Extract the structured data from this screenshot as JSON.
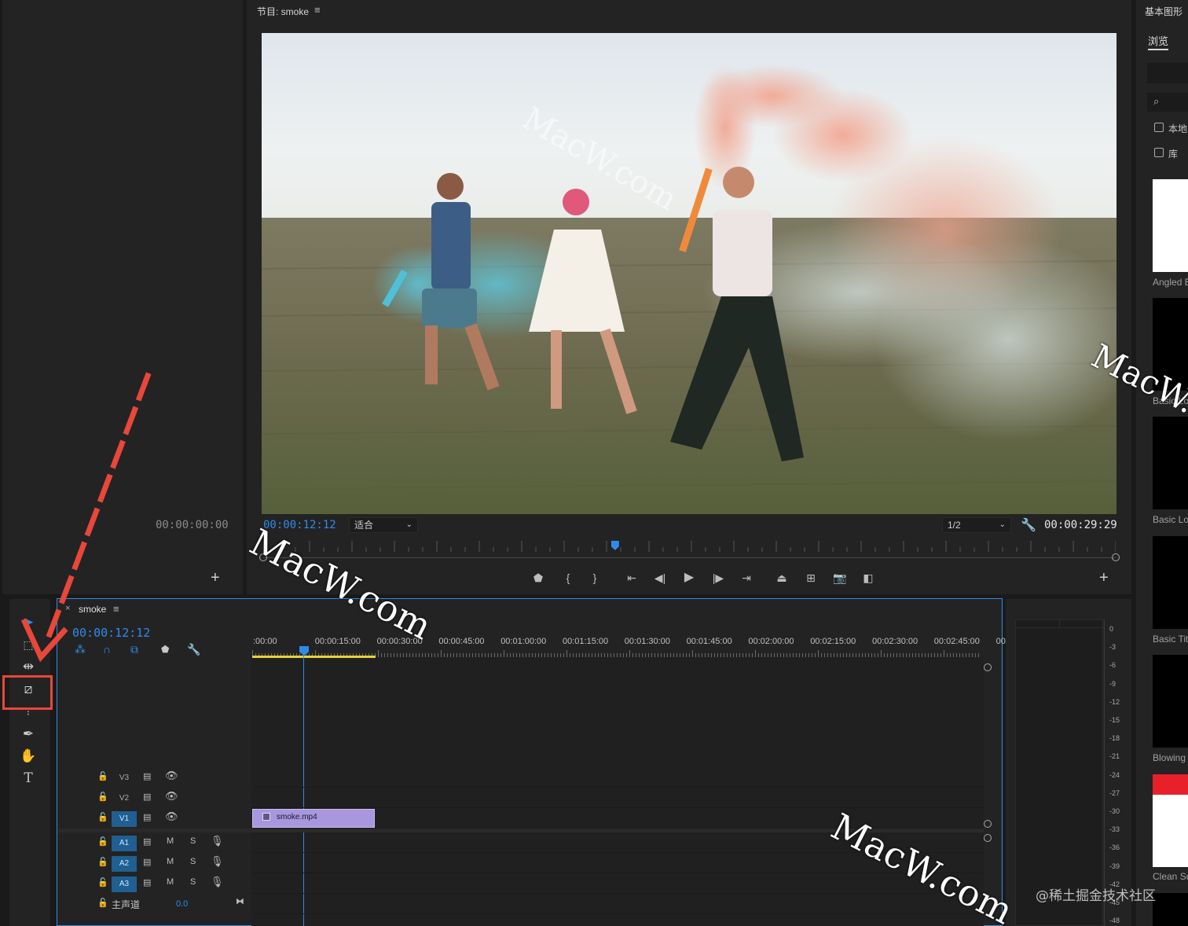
{
  "source_monitor": {
    "timecode": "00:00:00:00",
    "add_label": "+"
  },
  "program_monitor": {
    "title": "节目: smoke",
    "menu_icon": "≡",
    "timecode": "00:00:12:12",
    "zoom_select": "适合",
    "resolution_select": "1/2",
    "duration": "00:00:29:29",
    "add_label": "+",
    "playhead_progress": 0.41
  },
  "graphics_panel": {
    "title": "基本图形",
    "tab_browse": "浏览",
    "local_label": "本地",
    "lib_label": "库",
    "templates": [
      "Angled B",
      "Basic Lo",
      "Basic Lo",
      "Basic Titl",
      "Blowing",
      "Clean Sq"
    ]
  },
  "timeline": {
    "sequence_name": "smoke",
    "close_label": "×",
    "menu_icon": "≡",
    "timecode": "00:00:12:12",
    "ruler": [
      ":00:00",
      "00:00:15:00",
      "00:00:30:00",
      "00:00:45:00",
      "00:01:00:00",
      "00:01:15:00",
      "00:01:30:00",
      "00:01:45:00",
      "00:02:00:00",
      "00:02:15:00",
      "00:02:30:00",
      "00:02:45:00",
      "00"
    ],
    "tracks": {
      "v3": "V3",
      "v2": "V2",
      "v1": "V1",
      "a1": "A1",
      "a2": "A2",
      "a3": "A3",
      "mute": "M",
      "solo": "S",
      "master_label": "主声道",
      "master_value": "0.0"
    },
    "clip_name": "smoke.mp4"
  },
  "meters": [
    "0",
    "-3",
    "-6",
    "-9",
    "-12",
    "-15",
    "-18",
    "-21",
    "-24",
    "-27",
    "-30",
    "-33",
    "-36",
    "-39",
    "-42",
    "-45",
    "-48"
  ],
  "watermarks": {
    "macw": "MacW.com",
    "juejin": "@稀土掘金技术社区"
  },
  "colors": {
    "accent": "#2d8ceb",
    "clip": "#a896de",
    "highlight": "#e8473a",
    "work_area": "#e8d23a"
  }
}
